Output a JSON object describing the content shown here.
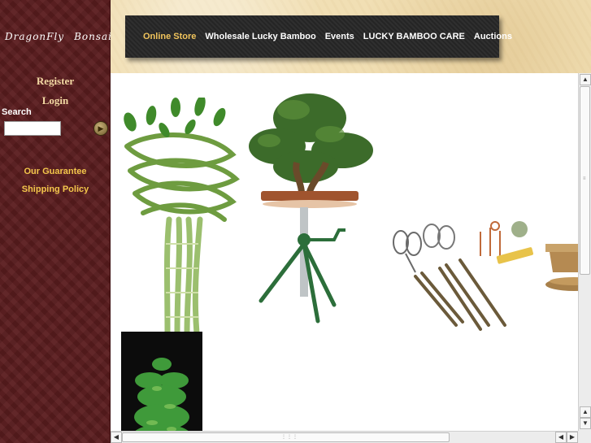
{
  "logo": {
    "word1": "DragonFly",
    "word2": "Bonsai"
  },
  "sidebar": {
    "register": "Register",
    "login": "Login",
    "search_label": "Search",
    "search_value": "",
    "guarantee": "Our Guarantee",
    "shipping": "Shipping Policy"
  },
  "nav": [
    {
      "label": "Online Store"
    },
    {
      "label": "Wholesale Lucky Bamboo"
    },
    {
      "label": "Events"
    },
    {
      "label": "LUCKY BAMBOO CARE"
    },
    {
      "label": "Auctions"
    }
  ],
  "colors": {
    "sidebar": "#5a1c1e",
    "header": "#f1dfb4",
    "nav_active": "#f1c45c",
    "side_link": "#f3d9a4",
    "side_small": "#f3c64b"
  }
}
